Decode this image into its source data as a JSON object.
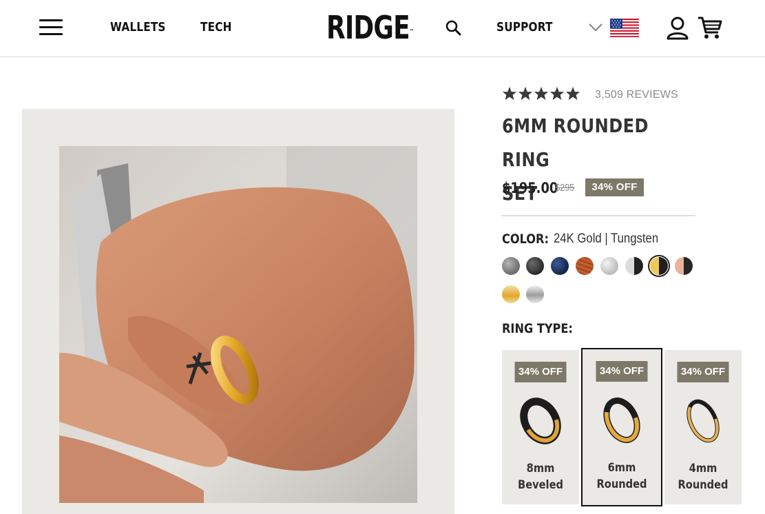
{
  "header": {
    "nav_left": [
      "WALLETS",
      "TECH"
    ],
    "logo": "RIDGE",
    "logo_tm": "™",
    "nav_right": "SUPPORT",
    "icons": [
      "menu-icon",
      "search-icon",
      "chevron-down-icon",
      "us-flag-icon",
      "user-icon",
      "cart-icon"
    ]
  },
  "product": {
    "rating_stars": 5,
    "reviews": "3,509 REVIEWS",
    "title_line1": "6MM ROUNDED RING",
    "title_line2": "SET",
    "price": "$195.00",
    "old_price": "$295",
    "discount": "34% OFF",
    "color_label": "COLOR:",
    "color_value": "24K Gold | Tungsten",
    "swatches": [
      {
        "name": "gunmetal",
        "color": "#7a7a7a"
      },
      {
        "name": "matte-black",
        "color": "#3a3a3a"
      },
      {
        "name": "navy",
        "color": "#1e2f5a"
      },
      {
        "name": "wood",
        "color": "#b5552e"
      },
      {
        "name": "silver-sparkle",
        "color": "#cfcfcf"
      },
      {
        "name": "black-silver",
        "color": "#555555"
      },
      {
        "name": "black-gold",
        "color": "#2b2b2b",
        "selected": true
      },
      {
        "name": "rose-gold-black",
        "color": "#d7a28a"
      },
      {
        "name": "gold",
        "color": "#e6b94d"
      },
      {
        "name": "silver",
        "color": "#b9b9b9"
      }
    ],
    "ring_type_label": "RING TYPE:",
    "ring_types": [
      {
        "badge": "34% OFF",
        "size": "8mm",
        "style": "Beveled",
        "selected": false
      },
      {
        "badge": "34% OFF",
        "size": "6mm",
        "style": "Rounded",
        "selected": true
      },
      {
        "badge": "34% OFF",
        "size": "4mm",
        "style": "Rounded",
        "selected": false
      }
    ]
  },
  "colors": {
    "badge": "#7d7868",
    "panel": "#ebe9e5",
    "star": "#3a3a3a"
  }
}
